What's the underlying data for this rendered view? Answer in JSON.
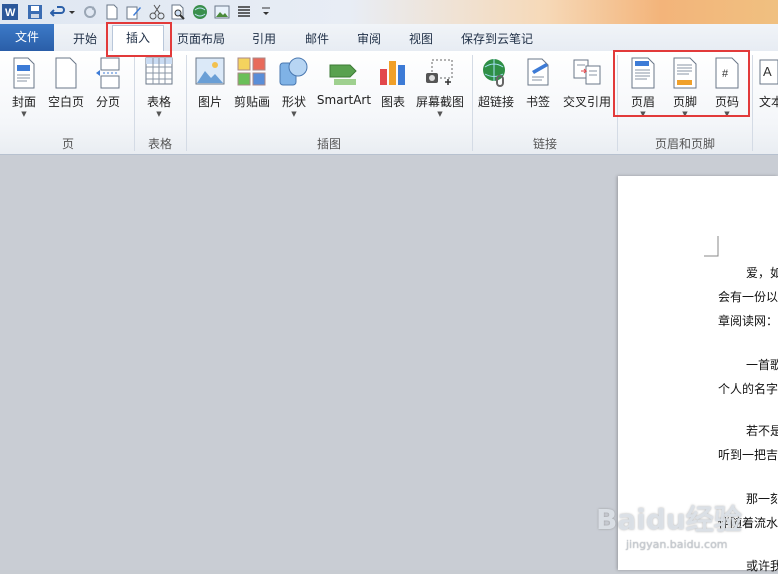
{
  "quick_access": {
    "icons": [
      "word-icon",
      "save-icon",
      "undo-icon",
      "redo-icon",
      "new-icon",
      "edit-icon",
      "cut-icon",
      "print-preview-icon",
      "web-icon",
      "picture-icon",
      "align-icon",
      "customize-icon"
    ]
  },
  "tabs": {
    "file": "文件",
    "items": [
      "开始",
      "插入",
      "页面布局",
      "引用",
      "邮件",
      "审阅",
      "视图",
      "保存到云笔记"
    ],
    "active": "插入"
  },
  "ribbon": {
    "groups": {
      "page": {
        "label": "页",
        "buttons": [
          "封面",
          "空白页",
          "分页"
        ]
      },
      "table": {
        "label": "表格",
        "buttons": [
          "表格"
        ]
      },
      "illustrations": {
        "label": "插图",
        "buttons": [
          "图片",
          "剪贴画",
          "形状",
          "SmartArt",
          "图表",
          "屏幕截图"
        ]
      },
      "links": {
        "label": "链接",
        "buttons": [
          "超链接",
          "书签",
          "交叉引用"
        ]
      },
      "header_footer": {
        "label": "页眉和页脚",
        "buttons": [
          "页眉",
          "页脚",
          "页码"
        ]
      },
      "text": {
        "buttons": [
          "文本"
        ]
      }
    }
  },
  "document": {
    "lines": [
      "爱，如",
      "会有一份以",
      "章阅读网：",
      "一首歌",
      "个人的名字",
      "若不是",
      "听到一把吉",
      "那一刻",
      "伴随着流水",
      "或许我"
    ]
  },
  "watermark": {
    "brand": "Baidu经验",
    "url": "jingyan.baidu.com"
  },
  "colors": {
    "accent_blue": "#2a5ea8",
    "highlight_red": "#e23a3a"
  }
}
